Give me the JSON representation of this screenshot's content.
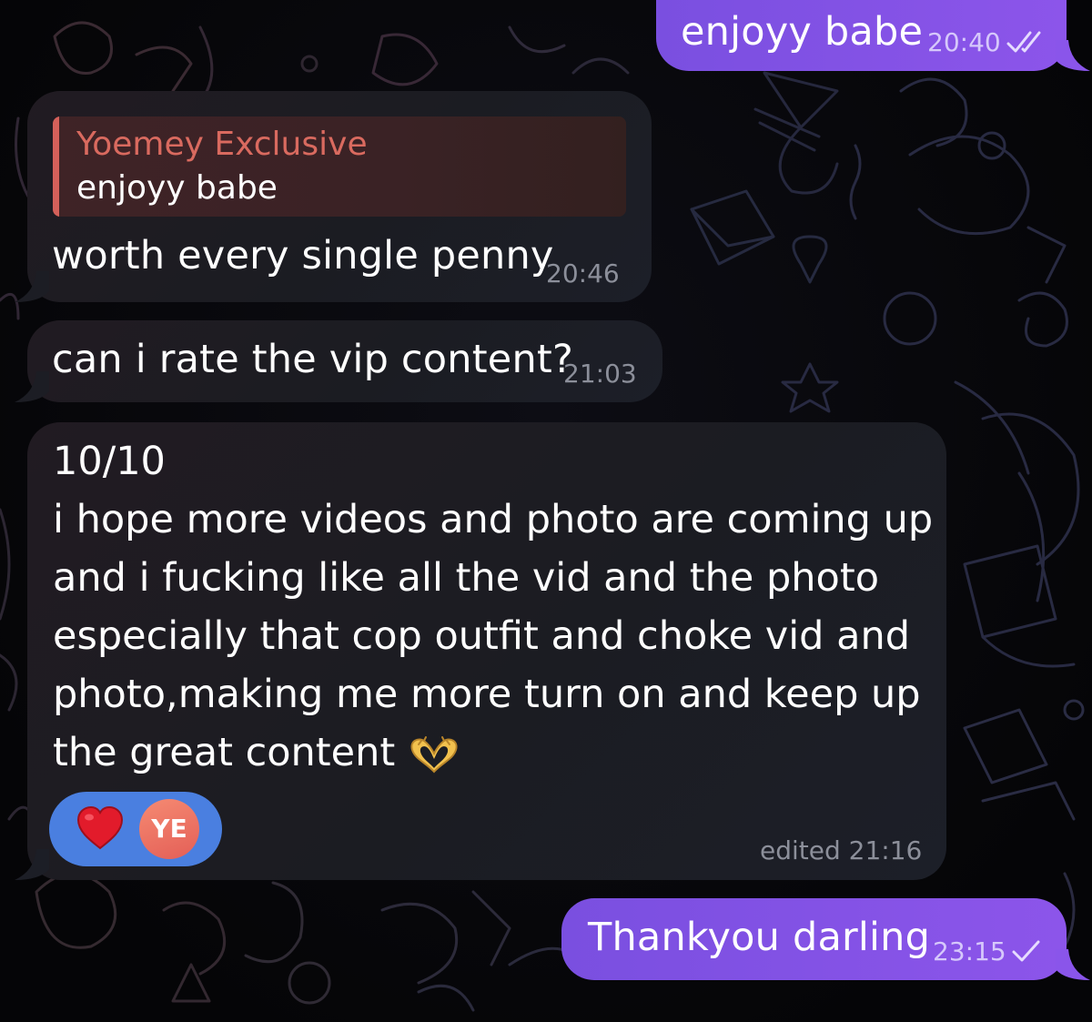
{
  "colors": {
    "outgoing_bubble": "#8455e8",
    "incoming_bubble": "#1d1c23",
    "reply_accent": "#d4605a",
    "reaction_pill": "#4a7fe0",
    "avatar": "#e86b5e"
  },
  "messages": [
    {
      "direction": "outgoing",
      "text": "enjoyy babe",
      "time": "20:40",
      "status_icon": "double-check-icon"
    },
    {
      "direction": "incoming",
      "reply_to": {
        "sender": "Yoemey Exclusive",
        "text": "enjoyy babe"
      },
      "text": "worth every single penny",
      "time": "20:46"
    },
    {
      "direction": "incoming",
      "text": "can i rate the vip content?",
      "time": "21:03"
    },
    {
      "direction": "incoming",
      "lines": [
        "10/10",
        "i hope more videos and photo are coming up",
        "and i fucking like all the vid and the photo",
        "especially that cop outfit and choke vid and",
        "photo,making me more turn on and keep up",
        "the great content"
      ],
      "emoji": "heart-hands-icon",
      "reactions": [
        {
          "type": "emoji",
          "icon": "red-heart-icon"
        },
        {
          "type": "avatar",
          "initials": "YE"
        }
      ],
      "time": "edited 21:16"
    },
    {
      "direction": "outgoing",
      "text": "Thankyou darling",
      "time": "23:15",
      "status_icon": "single-check-icon"
    }
  ]
}
